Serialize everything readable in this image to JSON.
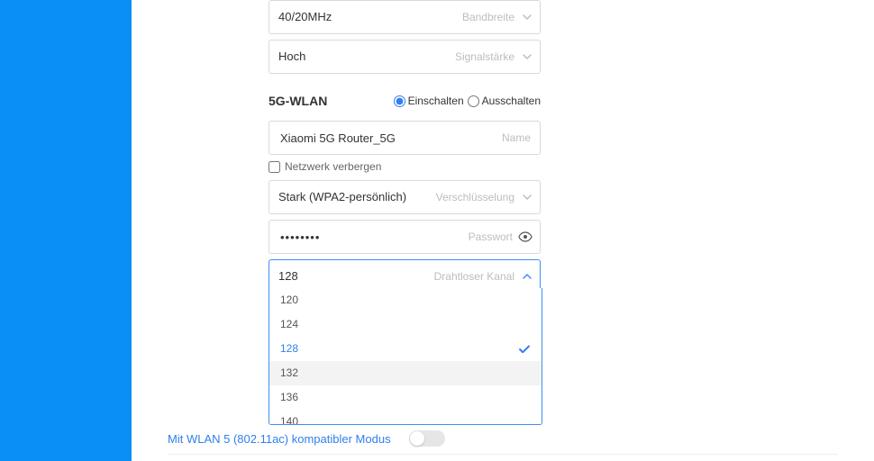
{
  "bandwidth": {
    "value": "40/20MHz",
    "label": "Bandbreite"
  },
  "signal": {
    "value": "Hoch",
    "label": "Signalstärke"
  },
  "section5g": {
    "title": "5G-WLAN",
    "radio_on": "Einschalten",
    "radio_off": "Ausschalten"
  },
  "name": {
    "value": "Xiaomi 5G Router_5G",
    "label": "Name"
  },
  "hide_net": {
    "label": "Netzwerk verbergen"
  },
  "encryption": {
    "value": "Stark (WPA2-persönlich)",
    "label": "Verschlüsselung"
  },
  "password": {
    "value": "••••••••",
    "label": "Passwort"
  },
  "channel": {
    "value": "128",
    "label": "Drahtloser Kanal"
  },
  "channel_options": [
    "120",
    "124",
    "128",
    "132",
    "136",
    "140"
  ],
  "channel_selected": "128",
  "channel_hover": "132",
  "compat": {
    "label": "Mit WLAN 5 (802.11ac) kompatibler Modus"
  }
}
